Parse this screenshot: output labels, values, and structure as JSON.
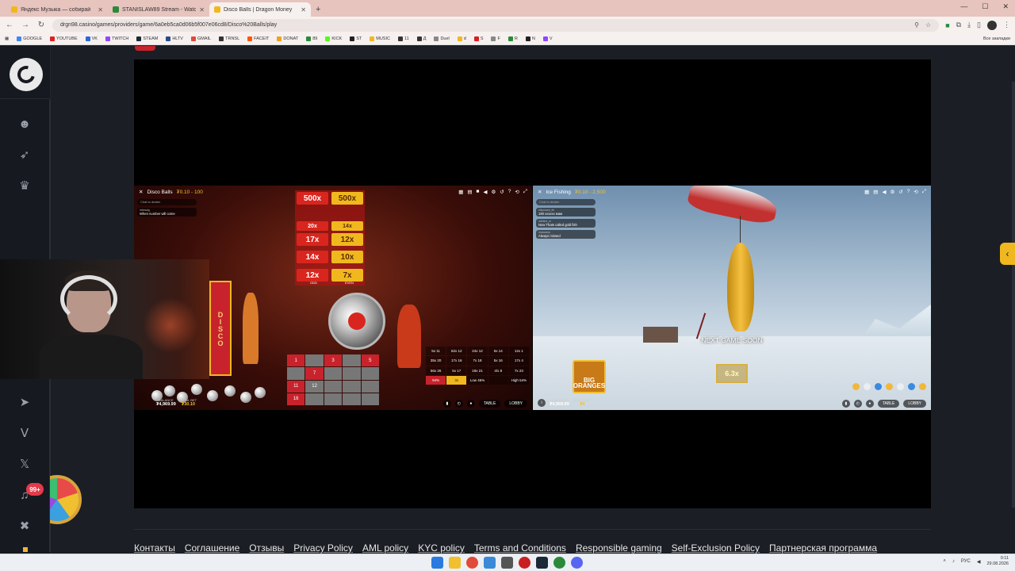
{
  "browser": {
    "tabs": [
      {
        "title": "Яндекс Музыка — собирай",
        "favicon_color": "#f0b81e",
        "active": false
      },
      {
        "title": "STANISLAW89 Stream - Watch",
        "favicon_color": "#2a8a3a",
        "active": false
      },
      {
        "title": "Disco Balls | Dragon Money",
        "favicon_color": "#f0b81e",
        "active": true
      }
    ],
    "new_tab": "+",
    "url": "drgn98.casino/games/providers/game/6a0eb5ca0d06b5f007e06cd8/Disco%20Balls/play",
    "bookmarks": [
      {
        "label": "GOOGLE",
        "color": "#4285f4"
      },
      {
        "label": "YOUTUBE",
        "color": "#e02020"
      },
      {
        "label": "VK",
        "color": "#2a6ad8"
      },
      {
        "label": "TWITCH",
        "color": "#9146ff"
      },
      {
        "label": "STEAM",
        "color": "#1b2838"
      },
      {
        "label": "HLTV",
        "color": "#2a4a8a"
      },
      {
        "label": "GMAIL",
        "color": "#e04a3a"
      },
      {
        "label": "TRNSL",
        "color": "#333333"
      },
      {
        "label": "FACEIT",
        "color": "#ff5500"
      },
      {
        "label": "DONAT",
        "color": "#f0a020"
      },
      {
        "label": "89",
        "color": "#2a8a3a"
      },
      {
        "label": "KICK",
        "color": "#53fc18"
      },
      {
        "label": "ST",
        "color": "#222222"
      },
      {
        "label": "MUSIC",
        "color": "#f0b81e"
      },
      {
        "label": "11",
        "color": "#333333"
      },
      {
        "label": "Д",
        "color": "#333333"
      },
      {
        "label": "Duel",
        "color": "#888888"
      },
      {
        "label": "d",
        "color": "#f0b81e"
      },
      {
        "label": "S",
        "color": "#d82020"
      },
      {
        "label": "F",
        "color": "#888888"
      },
      {
        "label": "R",
        "color": "#2a8a3a"
      },
      {
        "label": "N",
        "color": "#222222"
      },
      {
        "label": "V",
        "color": "#9146ff"
      }
    ],
    "all_bookmarks": "Все закладки"
  },
  "sidebar": {
    "badge": "99+"
  },
  "games": {
    "disco": {
      "name": "Disco Balls",
      "range": "₮0.10 - 100",
      "chat_input": "Chat to dealer",
      "chat": [
        {
          "user": "mbeadg",
          "text": "When number will come"
        }
      ],
      "multipliers": [
        {
          "label": "500x",
          "tone": "red"
        },
        {
          "label": "500x",
          "tone": "gold"
        },
        {
          "label": "20x",
          "tone": "red"
        },
        {
          "label": "14x",
          "tone": "gold"
        },
        {
          "label": "17x",
          "tone": "red"
        },
        {
          "label": "12x",
          "tone": "gold"
        },
        {
          "label": "14x",
          "tone": "red"
        },
        {
          "label": "10x",
          "tone": "gold"
        },
        {
          "label": "12x",
          "tone": "red"
        },
        {
          "label": "7x",
          "tone": "gold"
        }
      ],
      "odd_label": "ODD",
      "even_label": "EVEN",
      "sign": "DISCO",
      "grid": [
        {
          "v": "1",
          "c": "r"
        },
        {
          "v": "",
          "c": "g"
        },
        {
          "v": "3",
          "c": "r"
        },
        {
          "v": "",
          "c": "g"
        },
        {
          "v": "5",
          "c": "r"
        },
        {
          "v": "",
          "c": "g"
        },
        {
          "v": "7",
          "c": "r"
        },
        {
          "v": "",
          "c": "g"
        },
        {
          "v": "",
          "c": "g"
        },
        {
          "v": "",
          "c": "g"
        },
        {
          "v": "11",
          "c": "r"
        },
        {
          "v": "12",
          "c": "g"
        },
        {
          "v": "",
          "c": "g"
        },
        {
          "v": "",
          "c": "g"
        },
        {
          "v": "",
          "c": "g"
        },
        {
          "v": "16",
          "c": "r"
        },
        {
          "v": "",
          "c": "g"
        },
        {
          "v": "",
          "c": "g"
        },
        {
          "v": "",
          "c": "g"
        },
        {
          "v": "",
          "c": "g"
        }
      ],
      "stats": [
        "5x 11",
        "62x 12",
        "24x 12",
        "5x 14",
        "12x 1",
        "35x 20",
        "17x 16",
        "7x 18",
        "5x 16",
        "17x 4",
        "56x 26",
        "5x 17",
        "18x 21",
        "4/x 8",
        "7x 23",
        "94%",
        "3x",
        "Low 46%",
        "",
        "High 54%"
      ],
      "balance_label": "BALANCE",
      "balance": "₮4,969.99",
      "total_bet_label": "TOTAL BET",
      "total_bet": "₮30.10",
      "table_btn": "TABLE",
      "lobby_btn": "LOBBY"
    },
    "ice": {
      "name": "Ice Fishing",
      "range": "₮0.10 - 2,500",
      "chat_input": "Chat to dealer",
      "chat": [
        {
          "user": "billyshark_fin",
          "text": "180 хххххх мам"
        },
        {
          "user": "adeline_m",
          "text": "Now Thats called gold fish"
        },
        {
          "user": "mascamp",
          "text": "Always missed"
        }
      ],
      "next_game": "NEXT GAME SOON",
      "big_oranges": "BIG ORANGES",
      "multiplier": "6.3x",
      "balance_label": "BALANCE",
      "balance": "₮4,969.99",
      "bonus_label": "BONUS BET",
      "bonus": "₮0",
      "table_btn": "TABLE",
      "lobby_btn": "LOBBY"
    }
  },
  "footer": {
    "links": [
      "Контакты",
      "Соглашение",
      "Отзывы",
      "Privacy Policy",
      "AML policy",
      "KYC policy",
      "Terms and Conditions",
      "Responsible gaming",
      "Self-Exclusion Policy",
      "Партнерская программа"
    ]
  },
  "taskbar": {
    "lang": "РУС",
    "time": "0:11",
    "date": "29.08.2026"
  },
  "icons": [
    "back-icon",
    "forward-icon",
    "reload-icon",
    "zoom-icon",
    "star-icon",
    "extensions-icon",
    "menu-icon",
    "logo-icon",
    "close-icon",
    "chevron-left-icon",
    "bell-icon",
    "telegram-icon",
    "vk-icon",
    "x-icon",
    "sound-off-icon",
    "support-icon",
    "wheel-icon"
  ]
}
